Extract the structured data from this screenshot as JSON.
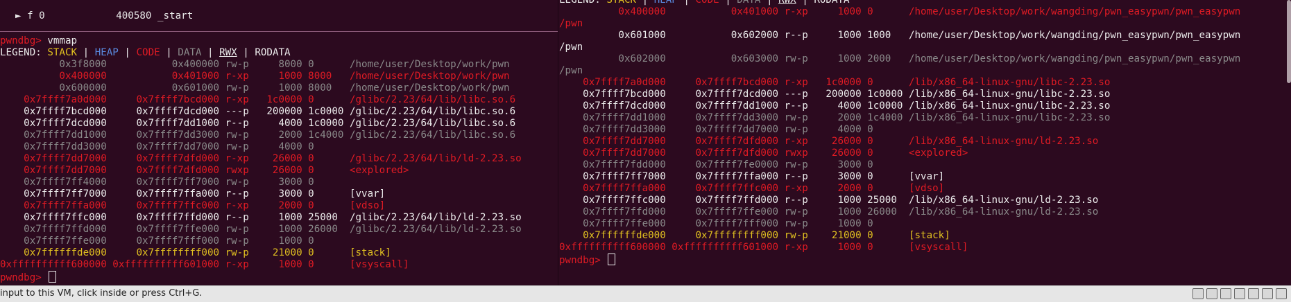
{
  "left": {
    "frame": {
      "arrow": "►",
      "label": "f 0",
      "address": "400580",
      "symbol": "_start"
    },
    "prompt": "pwndbg>",
    "command": "vmmap",
    "legend": {
      "prefix": "LEGEND:",
      "stack": "STACK",
      "heap": "HEAP",
      "code": "CODE",
      "data": "DATA",
      "rwx": "RWX",
      "rodata": "RODATA"
    },
    "rows": [
      {
        "start": "0x3f8000",
        "end": "0x400000",
        "perm": "rw-p",
        "size": "8000",
        "offset": "0",
        "path": "/home/user/Desktop/work/pwn",
        "color": "dim"
      },
      {
        "start": "0x400000",
        "end": "0x401000",
        "perm": "r-xp",
        "size": "1000",
        "offset": "8000",
        "path": "/home/user/Desktop/work/pwn",
        "color": "red"
      },
      {
        "start": "0x600000",
        "end": "0x601000",
        "perm": "rw-p",
        "size": "1000",
        "offset": "8000",
        "path": "/home/user/Desktop/work/pwn",
        "color": "dim"
      },
      {
        "start": "0x7ffff7a0d000",
        "end": "0x7ffff7bcd000",
        "perm": "r-xp",
        "size": "1c0000",
        "offset": "0",
        "path": "/glibc/2.23/64/lib/libc.so.6",
        "color": "red"
      },
      {
        "start": "0x7ffff7bcd000",
        "end": "0x7ffff7dcd000",
        "perm": "---p",
        "size": "200000",
        "offset": "1c0000",
        "path": "/glibc/2.23/64/lib/libc.so.6",
        "color": "white"
      },
      {
        "start": "0x7ffff7dcd000",
        "end": "0x7ffff7dd1000",
        "perm": "r--p",
        "size": "4000",
        "offset": "1c0000",
        "path": "/glibc/2.23/64/lib/libc.so.6",
        "color": "white"
      },
      {
        "start": "0x7ffff7dd1000",
        "end": "0x7ffff7dd3000",
        "perm": "rw-p",
        "size": "2000",
        "offset": "1c4000",
        "path": "/glibc/2.23/64/lib/libc.so.6",
        "color": "dim"
      },
      {
        "start": "0x7ffff7dd3000",
        "end": "0x7ffff7dd7000",
        "perm": "rw-p",
        "size": "4000",
        "offset": "0",
        "path": "",
        "color": "dim"
      },
      {
        "start": "0x7ffff7dd7000",
        "end": "0x7ffff7dfd000",
        "perm": "r-xp",
        "size": "26000",
        "offset": "0",
        "path": "/glibc/2.23/64/lib/ld-2.23.so",
        "color": "red"
      },
      {
        "start": "0x7ffff7dd7000",
        "end": "0x7ffff7dfd000",
        "perm": "rwxp",
        "size": "26000",
        "offset": "0",
        "path": "<explored>",
        "color": "red"
      },
      {
        "start": "0x7ffff7ff4000",
        "end": "0x7ffff7ff7000",
        "perm": "rw-p",
        "size": "3000",
        "offset": "0",
        "path": "",
        "color": "dim"
      },
      {
        "start": "0x7ffff7ff7000",
        "end": "0x7ffff7ffa000",
        "perm": "r--p",
        "size": "3000",
        "offset": "0",
        "path": "[vvar]",
        "color": "white"
      },
      {
        "start": "0x7ffff7ffa000",
        "end": "0x7ffff7ffc000",
        "perm": "r-xp",
        "size": "2000",
        "offset": "0",
        "path": "[vdso]",
        "color": "red"
      },
      {
        "start": "0x7ffff7ffc000",
        "end": "0x7ffff7ffd000",
        "perm": "r--p",
        "size": "1000",
        "offset": "25000",
        "path": "/glibc/2.23/64/lib/ld-2.23.so",
        "color": "white"
      },
      {
        "start": "0x7ffff7ffd000",
        "end": "0x7ffff7ffe000",
        "perm": "rw-p",
        "size": "1000",
        "offset": "26000",
        "path": "/glibc/2.23/64/lib/ld-2.23.so",
        "color": "dim"
      },
      {
        "start": "0x7ffff7ffe000",
        "end": "0x7ffff7fff000",
        "perm": "rw-p",
        "size": "1000",
        "offset": "0",
        "path": "",
        "color": "dim"
      },
      {
        "start": "0x7ffffffde000",
        "end": "0x7ffffffff000",
        "perm": "rw-p",
        "size": "21000",
        "offset": "0",
        "path": "[stack]",
        "color": "yellow"
      },
      {
        "start": "0xffffffffff600000",
        "end": "0xffffffffff601000",
        "perm": "r-xp",
        "size": "1000",
        "offset": "0",
        "path": "[vsyscall]",
        "color": "red"
      }
    ]
  },
  "right": {
    "legend": {
      "prefix": "LEGEND:",
      "stack": "STACK",
      "heap": "HEAP",
      "code": "CODE",
      "data": "DATA",
      "rwx": "RWX",
      "rodata": "RODATA"
    },
    "prompt": "pwndbg>",
    "rows": [
      {
        "start": "0x400000",
        "end": "0x401000",
        "perm": "r-xp",
        "size": "1000",
        "offset": "0",
        "path": "/home/user/Desktop/work/wangding/pwn_easypwn/pwn_easypwn",
        "wrap": "/pwn",
        "color": "red"
      },
      {
        "start": "0x601000",
        "end": "0x602000",
        "perm": "r--p",
        "size": "1000",
        "offset": "1000",
        "path": "/home/user/Desktop/work/wangding/pwn_easypwn/pwn_easypwn",
        "wrap": "/pwn",
        "color": "white"
      },
      {
        "start": "0x602000",
        "end": "0x603000",
        "perm": "rw-p",
        "size": "1000",
        "offset": "2000",
        "path": "/home/user/Desktop/work/wangding/pwn_easypwn/pwn_easypwn",
        "wrap": "/pwn",
        "color": "dim"
      },
      {
        "start": "0x7ffff7a0d000",
        "end": "0x7ffff7bcd000",
        "perm": "r-xp",
        "size": "1c0000",
        "offset": "0",
        "path": "/lib/x86_64-linux-gnu/libc-2.23.so",
        "color": "red"
      },
      {
        "start": "0x7ffff7bcd000",
        "end": "0x7ffff7dcd000",
        "perm": "---p",
        "size": "200000",
        "offset": "1c0000",
        "path": "/lib/x86_64-linux-gnu/libc-2.23.so",
        "color": "white"
      },
      {
        "start": "0x7ffff7dcd000",
        "end": "0x7ffff7dd1000",
        "perm": "r--p",
        "size": "4000",
        "offset": "1c0000",
        "path": "/lib/x86_64-linux-gnu/libc-2.23.so",
        "color": "white"
      },
      {
        "start": "0x7ffff7dd1000",
        "end": "0x7ffff7dd3000",
        "perm": "rw-p",
        "size": "2000",
        "offset": "1c4000",
        "path": "/lib/x86_64-linux-gnu/libc-2.23.so",
        "color": "dim"
      },
      {
        "start": "0x7ffff7dd3000",
        "end": "0x7ffff7dd7000",
        "perm": "rw-p",
        "size": "4000",
        "offset": "0",
        "path": "",
        "color": "dim"
      },
      {
        "start": "0x7ffff7dd7000",
        "end": "0x7ffff7dfd000",
        "perm": "r-xp",
        "size": "26000",
        "offset": "0",
        "path": "/lib/x86_64-linux-gnu/ld-2.23.so",
        "color": "red"
      },
      {
        "start": "0x7ffff7dd7000",
        "end": "0x7ffff7dfd000",
        "perm": "rwxp",
        "size": "26000",
        "offset": "0",
        "path": "<explored>",
        "color": "red"
      },
      {
        "start": "0x7ffff7fdd000",
        "end": "0x7ffff7fe0000",
        "perm": "rw-p",
        "size": "3000",
        "offset": "0",
        "path": "",
        "color": "dim"
      },
      {
        "start": "0x7ffff7ff7000",
        "end": "0x7ffff7ffa000",
        "perm": "r--p",
        "size": "3000",
        "offset": "0",
        "path": "[vvar]",
        "color": "white"
      },
      {
        "start": "0x7ffff7ffa000",
        "end": "0x7ffff7ffc000",
        "perm": "r-xp",
        "size": "2000",
        "offset": "0",
        "path": "[vdso]",
        "color": "red"
      },
      {
        "start": "0x7ffff7ffc000",
        "end": "0x7ffff7ffd000",
        "perm": "r--p",
        "size": "1000",
        "offset": "25000",
        "path": "/lib/x86_64-linux-gnu/ld-2.23.so",
        "color": "white"
      },
      {
        "start": "0x7ffff7ffd000",
        "end": "0x7ffff7ffe000",
        "perm": "rw-p",
        "size": "1000",
        "offset": "26000",
        "path": "/lib/x86_64-linux-gnu/ld-2.23.so",
        "color": "dim"
      },
      {
        "start": "0x7ffff7ffe000",
        "end": "0x7ffff7fff000",
        "perm": "rw-p",
        "size": "1000",
        "offset": "0",
        "path": "",
        "color": "dim"
      },
      {
        "start": "0x7ffffffde000",
        "end": "0x7ffffffff000",
        "perm": "rw-p",
        "size": "21000",
        "offset": "0",
        "path": "[stack]",
        "color": "yellow"
      },
      {
        "start": "0xffffffffff600000",
        "end": "0xffffffffff601000",
        "perm": "r-xp",
        "size": "1000",
        "offset": "0",
        "path": "[vsyscall]",
        "color": "red"
      }
    ]
  },
  "statusbar": {
    "message": "input to this VM, click inside or press Ctrl+G."
  },
  "colors": {
    "background": "#2c0a1f",
    "red": "#e01b24",
    "dim": "#8a8a8a",
    "white": "#ececec",
    "yellow": "#e0c020",
    "blue": "#5a8ae0"
  }
}
